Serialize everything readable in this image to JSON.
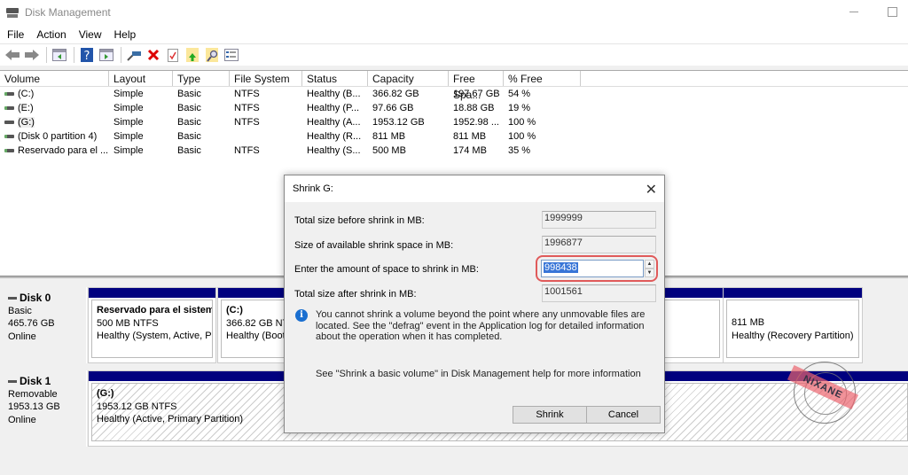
{
  "window": {
    "title": "Disk Management"
  },
  "menu": [
    "File",
    "Action",
    "View",
    "Help"
  ],
  "toolbar": {
    "icons": [
      "back-icon",
      "forward-icon",
      "console-tree-icon",
      "help-icon",
      "action-pane-icon",
      "connect-icon",
      "delete-icon",
      "properties-icon",
      "import-icon",
      "search-icon",
      "settings-list-icon"
    ]
  },
  "volume_list": {
    "columns": [
      "Volume",
      "Layout",
      "Type",
      "File System",
      "Status",
      "Capacity",
      "Free Spa...",
      "% Free"
    ],
    "rows": [
      {
        "volume": "(C:)",
        "layout": "Simple",
        "type": "Basic",
        "fs": "NTFS",
        "status": "Healthy (B...",
        "capacity": "366.82 GB",
        "free": "197.67 GB",
        "pct": "54 %"
      },
      {
        "volume": "(E:)",
        "layout": "Simple",
        "type": "Basic",
        "fs": "NTFS",
        "status": "Healthy (P...",
        "capacity": "97.66 GB",
        "free": "18.88 GB",
        "pct": "19 %"
      },
      {
        "volume": "(G:)",
        "layout": "Simple",
        "type": "Basic",
        "fs": "NTFS",
        "status": "Healthy (A...",
        "capacity": "1953.12 GB",
        "free": "1952.98 ...",
        "pct": "100 %"
      },
      {
        "volume": "(Disk 0 partition 4)",
        "layout": "Simple",
        "type": "Basic",
        "fs": "",
        "status": "Healthy (R...",
        "capacity": "811 MB",
        "free": "811 MB",
        "pct": "100 %"
      },
      {
        "volume": "Reservado para el ...",
        "layout": "Simple",
        "type": "Basic",
        "fs": "NTFS",
        "status": "Healthy (S...",
        "capacity": "500 MB",
        "free": "174 MB",
        "pct": "35 %"
      }
    ]
  },
  "disks": [
    {
      "name": "Disk 0",
      "kind": "Basic",
      "size": "465.76 GB",
      "state": "Online",
      "partitions": [
        {
          "name": "Reservado para el sistem",
          "size": "500 MB NTFS",
          "status": "Healthy (System, Active, P"
        },
        {
          "name": "(C:)",
          "size": "366.82 GB NTF",
          "status": "Healthy (Boot"
        },
        {
          "name": "",
          "size": "811 MB",
          "status": "Healthy (Recovery Partition)"
        }
      ]
    },
    {
      "name": "Disk 1",
      "kind": "Removable",
      "size": "1953.13 GB",
      "state": "Online",
      "partitions": [
        {
          "name": "(G:)",
          "size": "1953.12 GB NTFS",
          "status": "Healthy (Active, Primary Partition)"
        }
      ]
    }
  ],
  "dialog": {
    "title": "Shrink G:",
    "fields": [
      {
        "label": "Total size before shrink in MB:",
        "value": "1999999"
      },
      {
        "label": "Size of available shrink space in MB:",
        "value": "1996877"
      },
      {
        "label": "Enter the amount of space to shrink in MB:",
        "value": "998438"
      },
      {
        "label": "Total size after shrink in MB:",
        "value": "1001561"
      }
    ],
    "info": "You cannot shrink a volume beyond the point where any unmovable files are located. See the \"defrag\" event in the Application log for detailed information about the operation when it has completed.",
    "help": "See \"Shrink a basic volume\" in Disk Management help for more information",
    "shrink_label": "Shrink",
    "cancel_label": "Cancel"
  },
  "watermark": "NIXANE",
  "colors": {
    "partition_bar": "#00007f",
    "highlight": "#e05a5a",
    "selection": "#3875d7",
    "info": "#1a6fd0"
  }
}
